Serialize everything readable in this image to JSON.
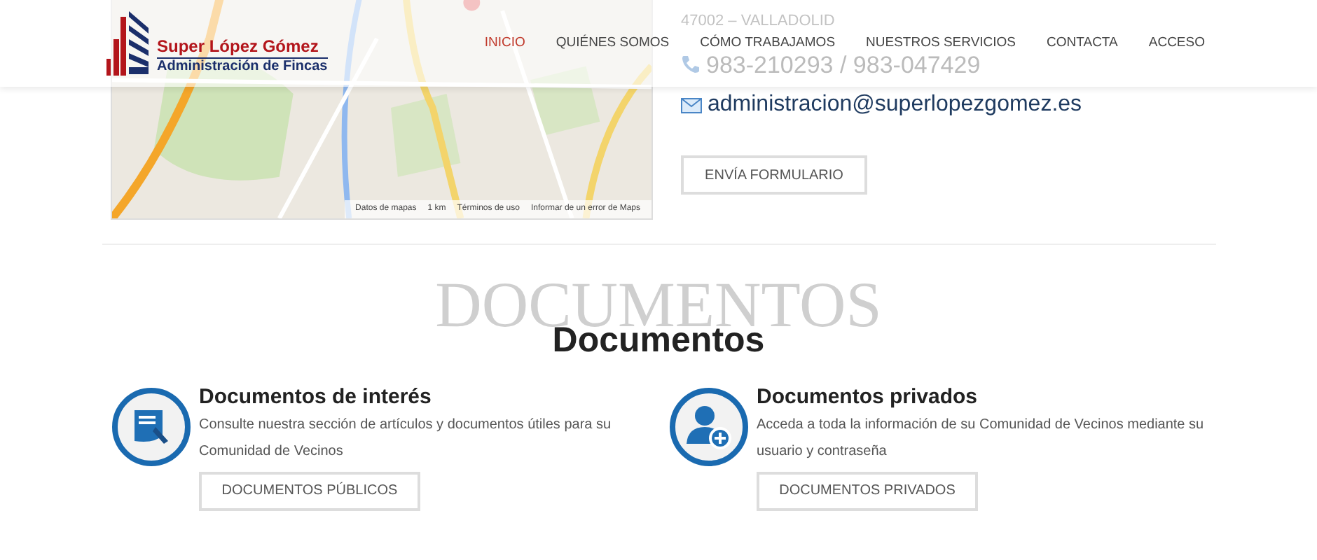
{
  "header": {
    "logo": {
      "name": "Super López Gómez",
      "tagline": "Administración de Fincas"
    },
    "nav": [
      {
        "label": "INICIO",
        "selected": true
      },
      {
        "label": "QUIÉNES SOMOS",
        "selected": false
      },
      {
        "label": "CÓMO TRABAJAMOS",
        "selected": false
      },
      {
        "label": "NUESTROS SERVICIOS",
        "selected": false
      },
      {
        "label": "CONTACTA",
        "selected": false
      },
      {
        "label": "ACCESO",
        "selected": false
      }
    ]
  },
  "map": {
    "kind": "picture",
    "footer": [
      "Datos de mapas",
      "1 km",
      "Términos de uso",
      "Informar de un error de Maps"
    ]
  },
  "contact": {
    "address": "47002 – VALLADOLID",
    "phone": "983-210293 / 983-047429",
    "email": "administracion@superlopezgomez.es",
    "button": "ENVÍA FORMULARIO"
  },
  "documents": {
    "watermark": "DOCUMENTOS",
    "title": "Documentos",
    "items": [
      {
        "kind": "document",
        "title": "Documentos de interés",
        "text": "Consulte nuestra sección de artículos y documentos útiles para su Comunidad de Vecinos",
        "button": "DOCUMENTOS PÚBLICOS"
      },
      {
        "kind": "user",
        "title": "Documentos privados",
        "text": "Acceda a toda la información de su Comunidad de Vecinos mediante su usuario y contraseña",
        "button": "DOCUMENTOS PRIVADOS"
      }
    ]
  }
}
